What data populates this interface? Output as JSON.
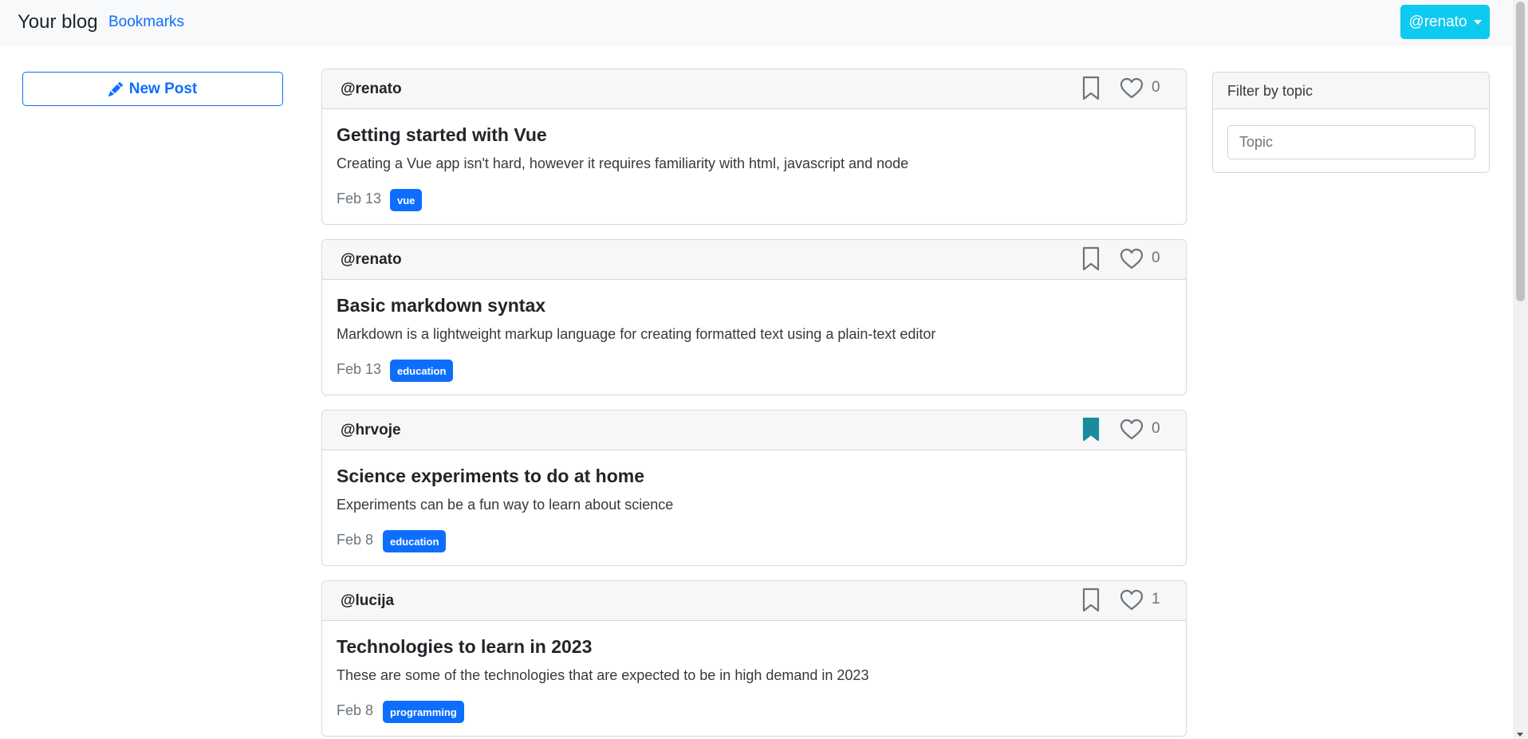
{
  "navbar": {
    "brand": "Your blog",
    "bookmarks_link": "Bookmarks",
    "user_menu": "@renato"
  },
  "sidebar": {
    "new_post_label": "New Post"
  },
  "posts": [
    {
      "author": "@renato",
      "bookmarked": false,
      "likes": "0",
      "title": "Getting started with Vue",
      "description": "Creating a Vue app isn't hard, however it requires familiarity with html, javascript and node",
      "date": "Feb 13",
      "tag": "vue"
    },
    {
      "author": "@renato",
      "bookmarked": false,
      "likes": "0",
      "title": "Basic markdown syntax",
      "description": "Markdown is a lightweight markup language for creating formatted text using a plain-text editor",
      "date": "Feb 13",
      "tag": "education"
    },
    {
      "author": "@hrvoje",
      "bookmarked": true,
      "likes": "0",
      "title": "Science experiments to do at home",
      "description": "Experiments can be a fun way to learn about science",
      "date": "Feb 8",
      "tag": "education"
    },
    {
      "author": "@lucija",
      "bookmarked": false,
      "likes": "1",
      "title": "Technologies to learn in 2023",
      "description": "These are some of the technologies that are expected to be in high demand in 2023",
      "date": "Feb 8",
      "tag": "programming"
    }
  ],
  "filter": {
    "header": "Filter by topic",
    "placeholder": "Topic",
    "value": ""
  },
  "colors": {
    "primary": "#0d6efd",
    "info": "#0dcaf0",
    "bookmark_active": "#1b8a9e",
    "icon_inactive": "#6c757d"
  }
}
